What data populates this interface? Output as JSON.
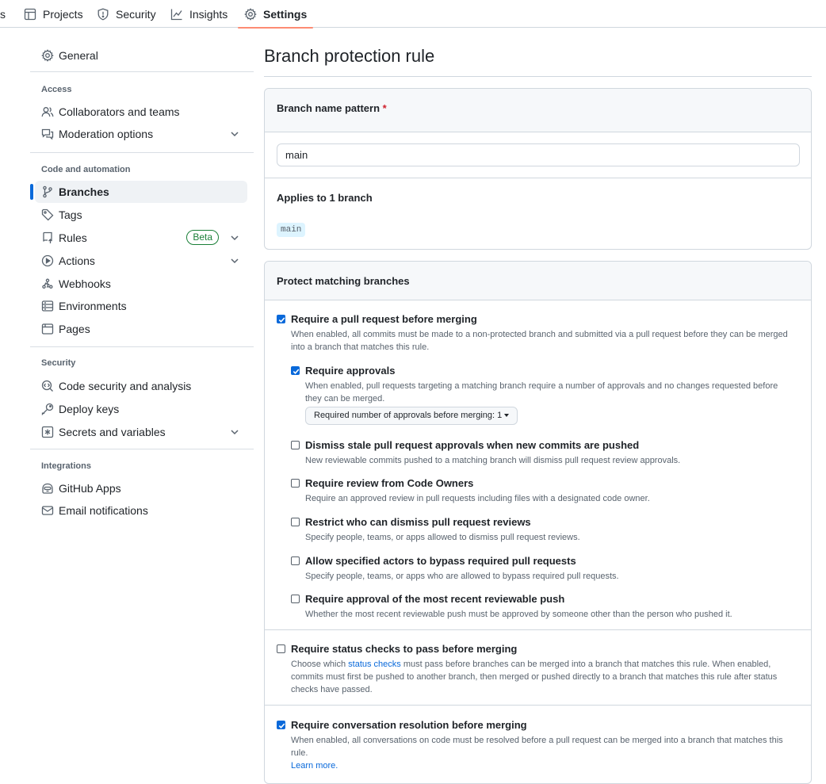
{
  "topnav": {
    "partial_tab": "s",
    "tabs": [
      {
        "label": "Projects",
        "icon": "table-icon"
      },
      {
        "label": "Security",
        "icon": "shield-icon"
      },
      {
        "label": "Insights",
        "icon": "graph-icon"
      },
      {
        "label": "Settings",
        "icon": "gear-icon",
        "active": true
      }
    ]
  },
  "sidebar": {
    "general": "General",
    "sections": {
      "access": "Access",
      "code_automation": "Code and automation",
      "security": "Security",
      "integrations": "Integrations"
    },
    "items": {
      "collaborators": "Collaborators and teams",
      "moderation": "Moderation options",
      "branches": "Branches",
      "tags": "Tags",
      "rules": "Rules",
      "rules_badge": "Beta",
      "actions": "Actions",
      "webhooks": "Webhooks",
      "environments": "Environments",
      "pages": "Pages",
      "code_security": "Code security and analysis",
      "deploy_keys": "Deploy keys",
      "secrets": "Secrets and variables",
      "github_apps": "GitHub Apps",
      "email_notifications": "Email notifications"
    }
  },
  "main": {
    "title": "Branch protection rule",
    "pattern_box": {
      "label": "Branch name pattern",
      "required_mark": "*",
      "input_value": "main",
      "applies_label": "Applies to 1 branch",
      "branch_chip": "main"
    },
    "protect_box": {
      "title": "Protect matching branches",
      "require_pr": {
        "checked": true,
        "label": "Require a pull request before merging",
        "desc": "When enabled, all commits must be made to a non-protected branch and submitted via a pull request before they can be merged into a branch that matches this rule."
      },
      "require_approvals": {
        "checked": true,
        "label": "Require approvals",
        "desc": "When enabled, pull requests targeting a matching branch require a number of approvals and no changes requested before they can be merged.",
        "dropdown_label": "Required number of approvals before merging: 1"
      },
      "dismiss_stale": {
        "checked": false,
        "label": "Dismiss stale pull request approvals when new commits are pushed",
        "desc": "New reviewable commits pushed to a matching branch will dismiss pull request review approvals."
      },
      "code_owners": {
        "checked": false,
        "label": "Require review from Code Owners",
        "desc": "Require an approved review in pull requests including files with a designated code owner."
      },
      "restrict_dismiss": {
        "checked": false,
        "label": "Restrict who can dismiss pull request reviews",
        "desc": "Specify people, teams, or apps allowed to dismiss pull request reviews."
      },
      "bypass": {
        "checked": false,
        "label": "Allow specified actors to bypass required pull requests",
        "desc": "Specify people, teams, or apps who are allowed to bypass required pull requests."
      },
      "recent_push": {
        "checked": false,
        "label": "Require approval of the most recent reviewable push",
        "desc": "Whether the most recent reviewable push must be approved by someone other than the person who pushed it."
      },
      "status_checks": {
        "checked": false,
        "label": "Require status checks to pass before merging",
        "desc_before": "Choose which ",
        "desc_link": "status checks",
        "desc_after": " must pass before branches can be merged into a branch that matches this rule. When enabled, commits must first be pushed to another branch, then merged or pushed directly to a branch that matches this rule after status checks have passed."
      },
      "conversation": {
        "checked": true,
        "label": "Require conversation resolution before merging",
        "desc": "When enabled, all conversations on code must be resolved before a pull request can be merged into a branch that matches this rule.",
        "link": "Learn more."
      }
    }
  }
}
